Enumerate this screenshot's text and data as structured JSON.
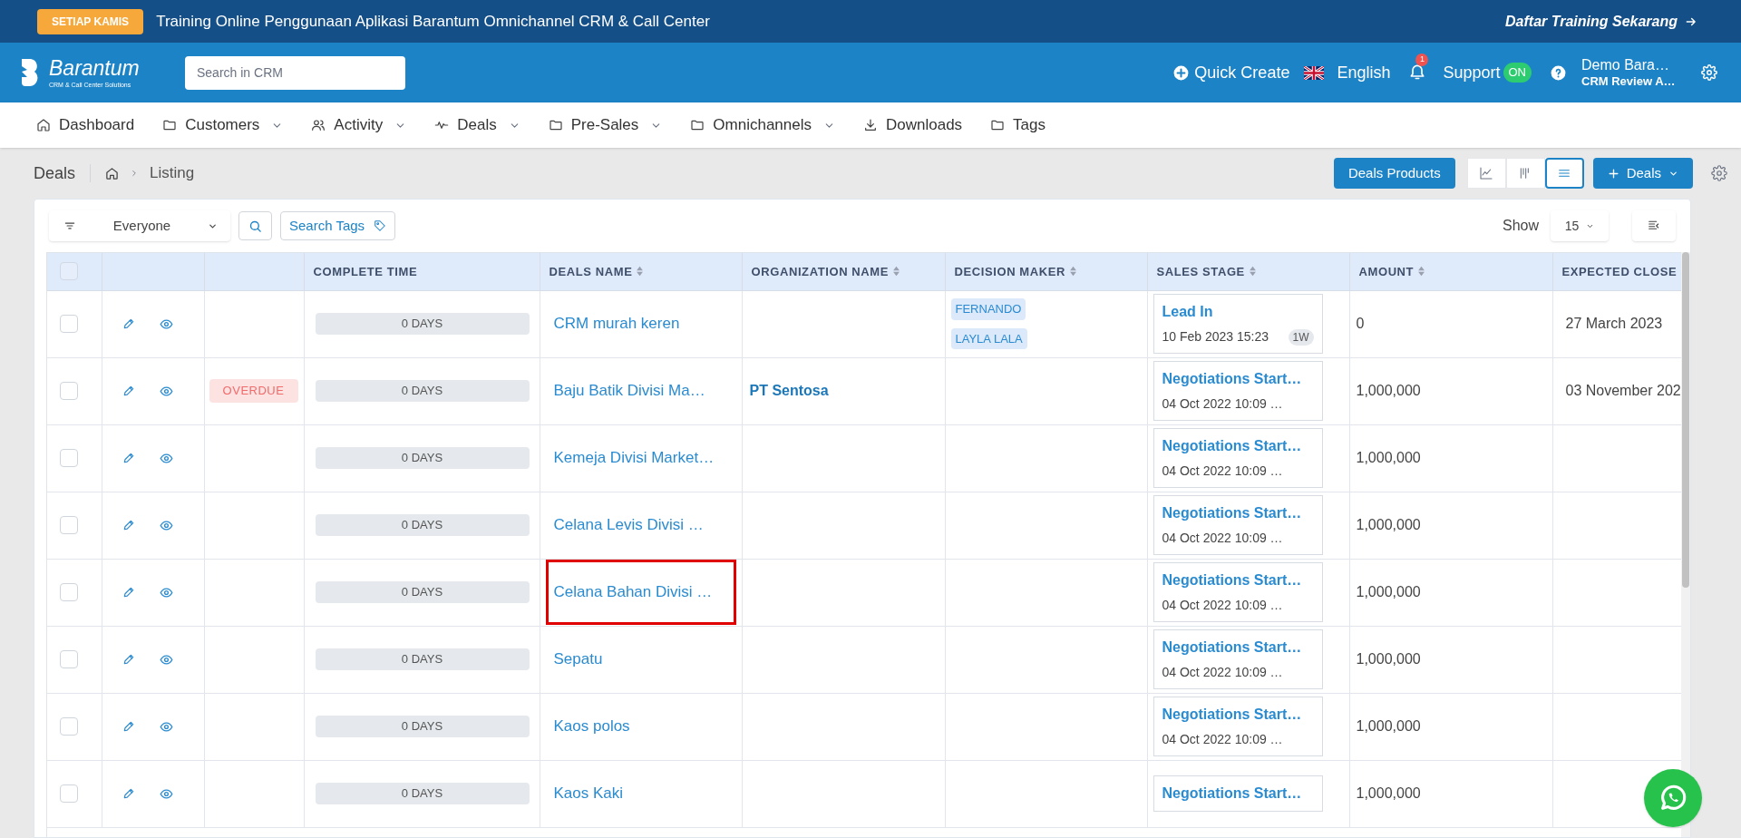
{
  "banner": {
    "badge": "SETIAP KAMIS",
    "text": "Training Online Penggunaan Aplikasi Barantum Omnichannel CRM & Call Center",
    "link": "Daftar Training Sekarang"
  },
  "header": {
    "logo": {
      "name": "Barantum",
      "tagline": "CRM & Call Center Solutions"
    },
    "search": {
      "placeholder": "Search in CRM"
    },
    "quick_create": "Quick Create",
    "language": "English",
    "notifications": "1",
    "support": {
      "label": "Support",
      "status": "ON",
      "on": true
    },
    "user": {
      "name": "Demo Bara…",
      "company": "CRM Review A…"
    }
  },
  "nav": {
    "items": [
      {
        "label": "Dashboard",
        "kind": "home",
        "dropdown": false
      },
      {
        "label": "Customers",
        "kind": "folder",
        "dropdown": true
      },
      {
        "label": "Activity",
        "kind": "users",
        "dropdown": true
      },
      {
        "label": "Deals",
        "kind": "pulse",
        "dropdown": true
      },
      {
        "label": "Pre-Sales",
        "kind": "folder",
        "dropdown": true
      },
      {
        "label": "Omnichannels",
        "kind": "folder",
        "dropdown": true
      },
      {
        "label": "Downloads",
        "kind": "download",
        "dropdown": false
      },
      {
        "label": "Tags",
        "kind": "folder",
        "dropdown": false
      }
    ]
  },
  "breadcrumb": {
    "title": "Deals",
    "current": "Listing"
  },
  "actions": {
    "products_button": "Deals Products",
    "views": [
      {
        "kind": "chart",
        "selected": false
      },
      {
        "kind": "kanban",
        "selected": false
      },
      {
        "kind": "list",
        "selected": true
      }
    ],
    "add_button": "Deals"
  },
  "filters": {
    "owner": "Everyone",
    "tags_button": "Search Tags",
    "show_label": "Show",
    "page_size": "15"
  },
  "table": {
    "select_all": {
      "checked": false
    },
    "columns": [
      {
        "label": "COMPLETE TIME",
        "sortable": false
      },
      {
        "label": "DEALS NAME",
        "sortable": true
      },
      {
        "label": "ORGANIZATION NAME",
        "sortable": true
      },
      {
        "label": "DECISION MAKER",
        "sortable": true
      },
      {
        "label": "SALES STAGE",
        "sortable": true
      },
      {
        "label": "AMOUNT",
        "sortable": true
      },
      {
        "label": "EXPECTED CLOSE",
        "sortable": false
      }
    ],
    "rows": [
      {
        "checked": false,
        "complete_time": "0 DAYS",
        "deal_name": "CRM murah keren",
        "highlighted": false,
        "decision_makers": [
          "FERNANDO",
          "LAYLA LALA"
        ],
        "stage": {
          "name": "Lead In",
          "date": "10 Feb 2023 15:23",
          "age": "1W"
        },
        "amount": "0",
        "expected_close": "27 March 2023"
      },
      {
        "checked": false,
        "status_badge": "OVERDUE",
        "complete_time": "0 DAYS",
        "deal_name": "Baju Batik Divisi Ma…",
        "highlighted": false,
        "organization": "PT Sentosa",
        "stage": {
          "name": "Negotiations Start…",
          "date": "04 Oct 2022 10:09 …"
        },
        "amount": "1,000,000",
        "expected_close": "03 November 202"
      },
      {
        "checked": false,
        "complete_time": "0 DAYS",
        "deal_name": "Kemeja Divisi Market…",
        "highlighted": false,
        "stage": {
          "name": "Negotiations Start…",
          "date": "04 Oct 2022 10:09 …"
        },
        "amount": "1,000,000"
      },
      {
        "checked": false,
        "complete_time": "0 DAYS",
        "deal_name": "Celana Levis Divisi …",
        "highlighted": false,
        "stage": {
          "name": "Negotiations Start…",
          "date": "04 Oct 2022 10:09 …"
        },
        "amount": "1,000,000"
      },
      {
        "checked": false,
        "complete_time": "0 DAYS",
        "deal_name": "Celana Bahan Divisi …",
        "highlighted": true,
        "stage": {
          "name": "Negotiations Start…",
          "date": "04 Oct 2022 10:09 …"
        },
        "amount": "1,000,000"
      },
      {
        "checked": false,
        "complete_time": "0 DAYS",
        "deal_name": "Sepatu",
        "highlighted": false,
        "stage": {
          "name": "Negotiations Start…",
          "date": "04 Oct 2022 10:09 …"
        },
        "amount": "1,000,000"
      },
      {
        "checked": false,
        "complete_time": "0 DAYS",
        "deal_name": "Kaos polos",
        "highlighted": false,
        "stage": {
          "name": "Negotiations Start…",
          "date": "04 Oct 2022 10:09 …"
        },
        "amount": "1,000,000"
      },
      {
        "checked": false,
        "complete_time": "0 DAYS",
        "deal_name": "Kaos Kaki",
        "highlighted": false,
        "stage": {
          "name": "Negotiations Start…"
        },
        "amount": "1,000,000"
      }
    ]
  }
}
